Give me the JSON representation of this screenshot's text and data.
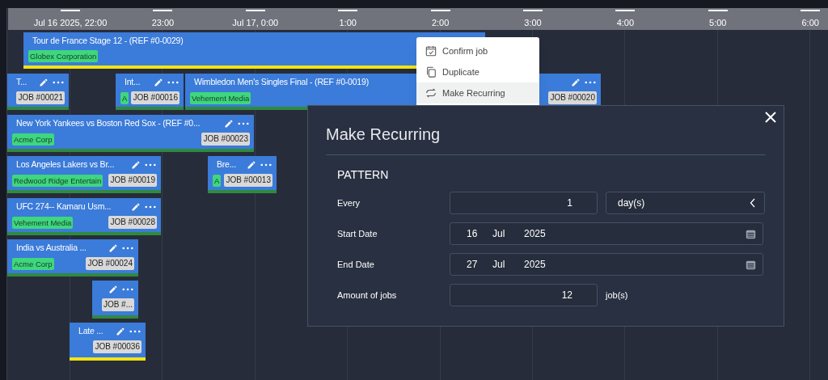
{
  "timeline": {
    "ticks": [
      "Jul 16 2025, 22:00",
      "23:00",
      "Jul 17, 0:00",
      "1:00",
      "2:00",
      "3:00",
      "4:00",
      "5:00",
      "6:00"
    ]
  },
  "jobs": [
    {
      "title": "Tour de France Stage 12 - (REF #0-0029)",
      "client": "Globex Corporation",
      "actions": false,
      "color": "#f2e411"
    },
    {
      "title": "T...",
      "job": "JOB #00021",
      "actions": true,
      "color": "#2f8a3f"
    },
    {
      "title": "Int...",
      "client": "A",
      "job": "JOB #00016",
      "actions": true,
      "color": "#2f8a3f"
    },
    {
      "title": "Wimbledon Men's Singles Final - (REF #0-0019)",
      "client": "Vehement Media",
      "job": "JOB #00020",
      "actions": true,
      "color": "#2f8a3f"
    },
    {
      "title": "New York Yankees vs Boston Red Sox - (REF #0...",
      "client": "Acme Corp",
      "job": "JOB #00023",
      "actions": true,
      "color": "#2f8a3f"
    },
    {
      "title": "Los Angeles Lakers vs Br...",
      "client": "Redwood Ridge Entertain",
      "job": "JOB #00019",
      "actions": true,
      "color": "#2f8a3f"
    },
    {
      "title": "Bre...",
      "client": "A",
      "job": "JOB #00013",
      "actions": true,
      "color": "#2f8a3f"
    },
    {
      "title": "UFC 274-- Kamaru Usm...",
      "client": "Vehement Media",
      "job": "JOB #00028",
      "actions": true,
      "color": "#2f8a3f"
    },
    {
      "title": "India vs Australia ...",
      "client": "Acme Corp",
      "job": "JOB #00024",
      "actions": true,
      "color": "#2f8a3f"
    },
    {
      "job": "JOB #...",
      "actions": true,
      "color": "#2f8a3f"
    },
    {
      "title": "Late ...",
      "job": "JOB #00036",
      "actions": true,
      "color": "#f2e411"
    }
  ],
  "context_menu": {
    "items": [
      {
        "kind": "confirm",
        "label": "Confirm job",
        "selected": false
      },
      {
        "kind": "duplicate",
        "label": "Duplicate",
        "selected": false
      },
      {
        "kind": "recurring",
        "label": "Make Recurring",
        "selected": true
      }
    ]
  },
  "dialog": {
    "title": "Make Recurring",
    "section": "PATTERN",
    "every": {
      "label": "Every",
      "value": "1",
      "unit": "day(s)"
    },
    "start_date": {
      "label": "Start Date",
      "day": "16",
      "month": "Jul",
      "year": "2025"
    },
    "end_date": {
      "label": "End Date",
      "day": "27",
      "month": "Jul",
      "year": "2025"
    },
    "amount": {
      "label": "Amount of jobs",
      "value": "12",
      "unit": "job(s)"
    }
  }
}
